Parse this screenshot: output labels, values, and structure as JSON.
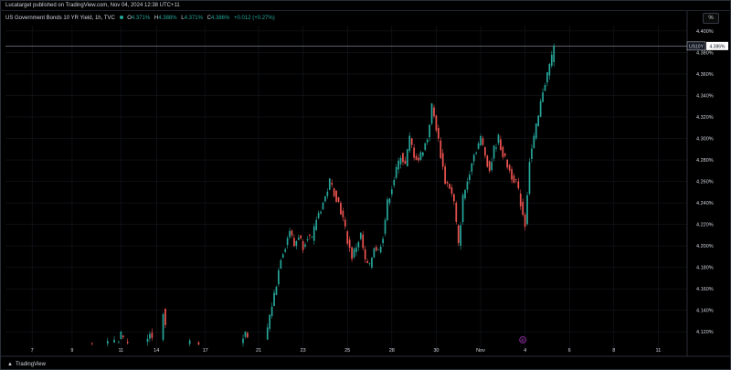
{
  "publish_bar": {
    "text": "Lucatarget published on TradingView.com, Nov 04, 2024 12:38 UTC+11"
  },
  "legend": {
    "title": "US Government Bonds 10 YR Yield, 1h, TVC",
    "o_label": "O",
    "o_value": "4.371%",
    "h_label": "H",
    "h_value": "4.388%",
    "l_label": "L",
    "l_value": "4.371%",
    "c_label": "C",
    "c_value": "4.386%",
    "change": "+0.012 (+0.27%)"
  },
  "scale_button": {
    "label": "%"
  },
  "logo": {
    "text": "TradingView"
  },
  "colors": {
    "up": "#26a69a",
    "down": "#ef5350",
    "grid": "#1a1d26",
    "axis_text": "#d1d4dc",
    "price_line": "#9598a1",
    "earnings_marker": "#9c27b0"
  },
  "chart_data": {
    "type": "candlestick",
    "symbol_tag": "US10Y",
    "last_price_label": "4.386%",
    "last_price": 4.386,
    "ylim": [
      4.11,
      4.405
    ],
    "y_ticks": [
      4.12,
      4.14,
      4.16,
      4.18,
      4.2,
      4.22,
      4.24,
      4.26,
      4.28,
      4.3,
      4.32,
      4.34,
      4.36,
      4.38,
      4.4
    ],
    "y_tick_labels": [
      "4.120%",
      "4.140%",
      "4.160%",
      "4.180%",
      "4.200%",
      "4.220%",
      "4.240%",
      "4.260%",
      "4.280%",
      "4.300%",
      "4.320%",
      "4.340%",
      "4.360%",
      "4.380%",
      "4.400%"
    ],
    "x_ticks": [
      "7",
      "9",
      "11",
      "14",
      "17",
      "21",
      "23",
      "25",
      "28",
      "30",
      "Nov",
      "4",
      "6",
      "8",
      "11"
    ],
    "x_tick_index": [
      0,
      18,
      40,
      56,
      78,
      102,
      122,
      142,
      162,
      182,
      202,
      222,
      242,
      262,
      282
    ],
    "earnings_marker_index": 221,
    "earnings_marker_label": "E",
    "path_points": [
      [
        0,
        4.11
      ],
      [
        38,
        4.11
      ],
      [
        40,
        4.118
      ],
      [
        42,
        4.11
      ],
      [
        51,
        4.11
      ],
      [
        53,
        4.118
      ],
      [
        55,
        4.11
      ],
      [
        58,
        4.112
      ],
      [
        59,
        4.14
      ],
      [
        60,
        4.125
      ],
      [
        61,
        4.11
      ],
      [
        94,
        4.11
      ],
      [
        96,
        4.12
      ],
      [
        98,
        4.11
      ],
      [
        105,
        4.112
      ],
      [
        107,
        4.135
      ],
      [
        108,
        4.145
      ],
      [
        110,
        4.165
      ],
      [
        112,
        4.19
      ],
      [
        114,
        4.2
      ],
      [
        116,
        4.215
      ],
      [
        118,
        4.2
      ],
      [
        120,
        4.21
      ],
      [
        122,
        4.2
      ],
      [
        124,
        4.21
      ],
      [
        126,
        4.205
      ],
      [
        128,
        4.225
      ],
      [
        130,
        4.235
      ],
      [
        132,
        4.245
      ],
      [
        134,
        4.26
      ],
      [
        136,
        4.25
      ],
      [
        138,
        4.24
      ],
      [
        140,
        4.225
      ],
      [
        142,
        4.205
      ],
      [
        144,
        4.19
      ],
      [
        146,
        4.2
      ],
      [
        148,
        4.21
      ],
      [
        150,
        4.185
      ],
      [
        152,
        4.18
      ],
      [
        154,
        4.2
      ],
      [
        156,
        4.195
      ],
      [
        158,
        4.21
      ],
      [
        160,
        4.24
      ],
      [
        162,
        4.255
      ],
      [
        164,
        4.27
      ],
      [
        166,
        4.285
      ],
      [
        168,
        4.275
      ],
      [
        170,
        4.3
      ],
      [
        172,
        4.285
      ],
      [
        174,
        4.28
      ],
      [
        176,
        4.29
      ],
      [
        178,
        4.3
      ],
      [
        180,
        4.33
      ],
      [
        182,
        4.31
      ],
      [
        184,
        4.285
      ],
      [
        186,
        4.26
      ],
      [
        188,
        4.255
      ],
      [
        190,
        4.24
      ],
      [
        192,
        4.2
      ],
      [
        194,
        4.245
      ],
      [
        196,
        4.26
      ],
      [
        198,
        4.28
      ],
      [
        200,
        4.29
      ],
      [
        202,
        4.3
      ],
      [
        204,
        4.285
      ],
      [
        206,
        4.27
      ],
      [
        208,
        4.29
      ],
      [
        210,
        4.3
      ],
      [
        212,
        4.285
      ],
      [
        214,
        4.275
      ],
      [
        216,
        4.265
      ],
      [
        218,
        4.26
      ],
      [
        220,
        4.24
      ],
      [
        222,
        4.22
      ],
      [
        224,
        4.28
      ],
      [
        226,
        4.3
      ],
      [
        228,
        4.32
      ],
      [
        230,
        4.345
      ],
      [
        232,
        4.36
      ],
      [
        234,
        4.376
      ],
      [
        235,
        4.386
      ]
    ]
  }
}
